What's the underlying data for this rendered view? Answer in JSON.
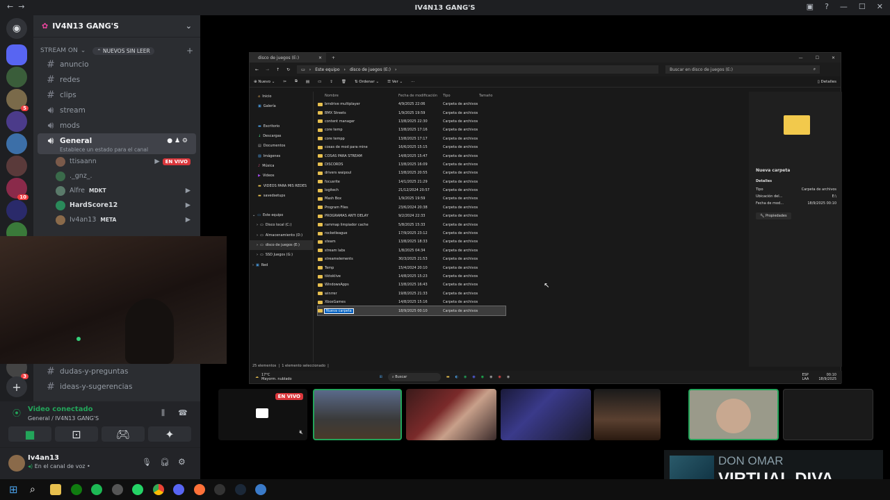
{
  "window": {
    "title": "IV4N13 GANG'S"
  },
  "server": {
    "name": "IV4N13 GANG'S",
    "category": "STREAM ON",
    "unread_pill": "NUEVOS SIN LEER",
    "channels": [
      {
        "name": "anuncio",
        "type": "text"
      },
      {
        "name": "redes",
        "type": "text"
      },
      {
        "name": "clips",
        "type": "text"
      },
      {
        "name": "stream",
        "type": "voice"
      },
      {
        "name": "mods",
        "type": "voice"
      }
    ],
    "voice_channel": {
      "name": "General",
      "status_placeholder": "Establece un estado para el canal",
      "users": [
        {
          "name": "ttisaann",
          "badge": "EN VIVO"
        },
        {
          "name": "._gnz_."
        },
        {
          "name": "Alfre",
          "tag": "MDKT"
        },
        {
          "name": "HardScore12"
        },
        {
          "name": "Iv4an13",
          "tag": "META"
        }
      ]
    },
    "more_channels": [
      {
        "name": "dudas-y-preguntas"
      },
      {
        "name": "ideas-y-sugerencias"
      }
    ],
    "rail_badges": [
      "5",
      "10",
      "3"
    ]
  },
  "voice_status": {
    "title": "Video conectado",
    "subtitle": "General / IV4N13 GANG'S"
  },
  "user": {
    "name": "Iv4an13",
    "status": "En el canal de voz •"
  },
  "explorer": {
    "tab": "disco de juegos (E:)",
    "breadcrumb": [
      "Este equipo",
      "disco de juegos (E:)"
    ],
    "search_placeholder": "Buscar en disco de juegos (E:)",
    "toolbar": [
      "Nuevo",
      "Ordenar",
      "Ver",
      "Detalles"
    ],
    "nav": [
      "Inicio",
      "Galería",
      "Escritorio",
      "Descargas",
      "Documentos",
      "Imágenes",
      "Música",
      "Videos",
      "VIDEOS PARA MIS REDES",
      "savedsetups",
      "Este equipo",
      "Disco local (C:)",
      "Almacenamiento (D:)",
      "disco de juegos (E:)",
      "SSD Juegos (G:)",
      "Red"
    ],
    "columns": [
      "Nombre",
      "Fecha de modificación",
      "Tipo",
      "Tamaño"
    ],
    "files": [
      [
        "bmdrive multiplayer",
        "4/9/2025 22:06",
        "Carpeta de archivos"
      ],
      [
        "BMX Streets",
        "1/9/2025 19:59",
        "Carpeta de archivos"
      ],
      [
        "content manager",
        "13/8/2025 22:30",
        "Carpeta de archivos"
      ],
      [
        "core temp",
        "13/8/2025 17:16",
        "Carpeta de archivos"
      ],
      [
        "core tempp",
        "13/8/2025 17:17",
        "Carpeta de archivos"
      ],
      [
        "cosas de mod para mine",
        "16/6/2025 15:15",
        "Carpeta de archivos"
      ],
      [
        "COSAS PARA STREAM",
        "14/8/2025 15:47",
        "Carpeta de archivos"
      ],
      [
        "DISCORDS",
        "13/8/2025 16:09",
        "Carpeta de archivos"
      ],
      [
        "drivers waipoul",
        "13/8/2025 20:55",
        "Carpeta de archivos"
      ],
      [
        "focusrite",
        "14/1/2025 21:29",
        "Carpeta de archivos"
      ],
      [
        "logitech",
        "21/12/2024 20:57",
        "Carpeta de archivos"
      ],
      [
        "Mash Box",
        "1/9/2025 19:59",
        "Carpeta de archivos"
      ],
      [
        "Program Files",
        "23/6/2024 20:38",
        "Carpeta de archivos"
      ],
      [
        "PROGRAMAS ANTI DELAY",
        "9/2/2024 22:33",
        "Carpeta de archivos"
      ],
      [
        "rammap limpiador cache",
        "5/8/2025 15:33",
        "Carpeta de archivos"
      ],
      [
        "rocketleague",
        "17/9/2025 23:12",
        "Carpeta de archivos"
      ],
      [
        "steam",
        "13/8/2025 18:33",
        "Carpeta de archivos"
      ],
      [
        "stream labs",
        "1/8/2025 04:34",
        "Carpeta de archivos"
      ],
      [
        "streamelements",
        "30/3/2025 21:53",
        "Carpeta de archivos"
      ],
      [
        "Temp",
        "15/4/2024 20:10",
        "Carpeta de archivos"
      ],
      [
        "tiktoklive",
        "14/8/2025 15:23",
        "Carpeta de archivos"
      ],
      [
        "WindowsApps",
        "13/8/2025 16:43",
        "Carpeta de archivos"
      ],
      [
        "winrrer",
        "19/8/2025 21:33",
        "Carpeta de archivos"
      ],
      [
        "XboxGames",
        "14/8/2025 15:16",
        "Carpeta de archivos"
      ],
      [
        "Nueva carpeta",
        "18/9/2025 00:10",
        "Carpeta de archivos"
      ]
    ],
    "details": {
      "name": "Nueva carpeta",
      "section": "Detalles",
      "rows": [
        [
          "Tipo",
          "Carpeta de archivos"
        ],
        [
          "Ubicación del...",
          "E:\\"
        ],
        [
          "Fecha de mod...",
          "18/9/2025 00:10"
        ]
      ],
      "properties": "Propiedades"
    },
    "status": [
      "25 elementos",
      "1 elemento seleccionado"
    ],
    "taskbar": {
      "weather": "17°C",
      "weather_sub": "Mayorm. nublado",
      "search": "Buscar",
      "lang": "ESP",
      "lang_sub": "LAA",
      "time": "00:10",
      "date": "18/9/2025"
    }
  },
  "tiles": {
    "live_badge": "EN VIVO"
  },
  "now_playing": {
    "artist": "DON OMAR",
    "song": "VIRTUAL DIVA"
  },
  "colors": {
    "discord_bg": "#2b2d31",
    "accent_green": "#23a55a",
    "live_red": "#da373c",
    "folder": "#e8c04e"
  }
}
